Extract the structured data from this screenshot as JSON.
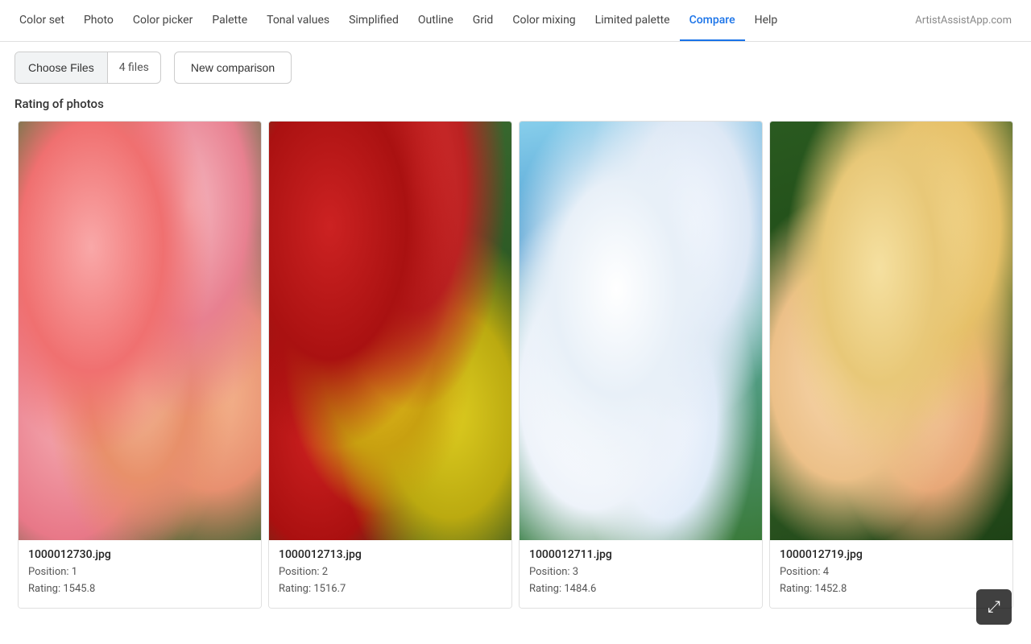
{
  "nav": {
    "items": [
      {
        "id": "color-set",
        "label": "Color set",
        "active": false
      },
      {
        "id": "photo",
        "label": "Photo",
        "active": false
      },
      {
        "id": "color-picker",
        "label": "Color picker",
        "active": false
      },
      {
        "id": "palette",
        "label": "Palette",
        "active": false
      },
      {
        "id": "tonal-values",
        "label": "Tonal values",
        "active": false
      },
      {
        "id": "simplified",
        "label": "Simplified",
        "active": false
      },
      {
        "id": "outline",
        "label": "Outline",
        "active": false
      },
      {
        "id": "grid",
        "label": "Grid",
        "active": false
      },
      {
        "id": "color-mixing",
        "label": "Color mixing",
        "active": false
      },
      {
        "id": "limited-palette",
        "label": "Limited palette",
        "active": false
      },
      {
        "id": "compare",
        "label": "Compare",
        "active": true
      },
      {
        "id": "help",
        "label": "Help",
        "active": false
      }
    ],
    "brand": "ArtistAssistApp.com"
  },
  "toolbar": {
    "choose_files_label": "Choose Files",
    "file_count": "4 files",
    "new_comparison_label": "New comparison"
  },
  "section": {
    "heading": "Rating of photos"
  },
  "images": [
    {
      "filename": "1000012730.jpg",
      "position": "Position: 1",
      "rating": "Rating: 1545.8",
      "img_class": "img-1"
    },
    {
      "filename": "1000012713.jpg",
      "position": "Position: 2",
      "rating": "Rating: 1516.7",
      "img_class": "img-2"
    },
    {
      "filename": "1000012711.jpg",
      "position": "Position: 3",
      "rating": "Rating: 1484.6",
      "img_class": "img-3"
    },
    {
      "filename": "1000012719.jpg",
      "position": "Position: 4",
      "rating": "Rating: 1452.8",
      "img_class": "img-4"
    }
  ],
  "zoom_button": {
    "icon": "⤢",
    "label": "zoom"
  }
}
